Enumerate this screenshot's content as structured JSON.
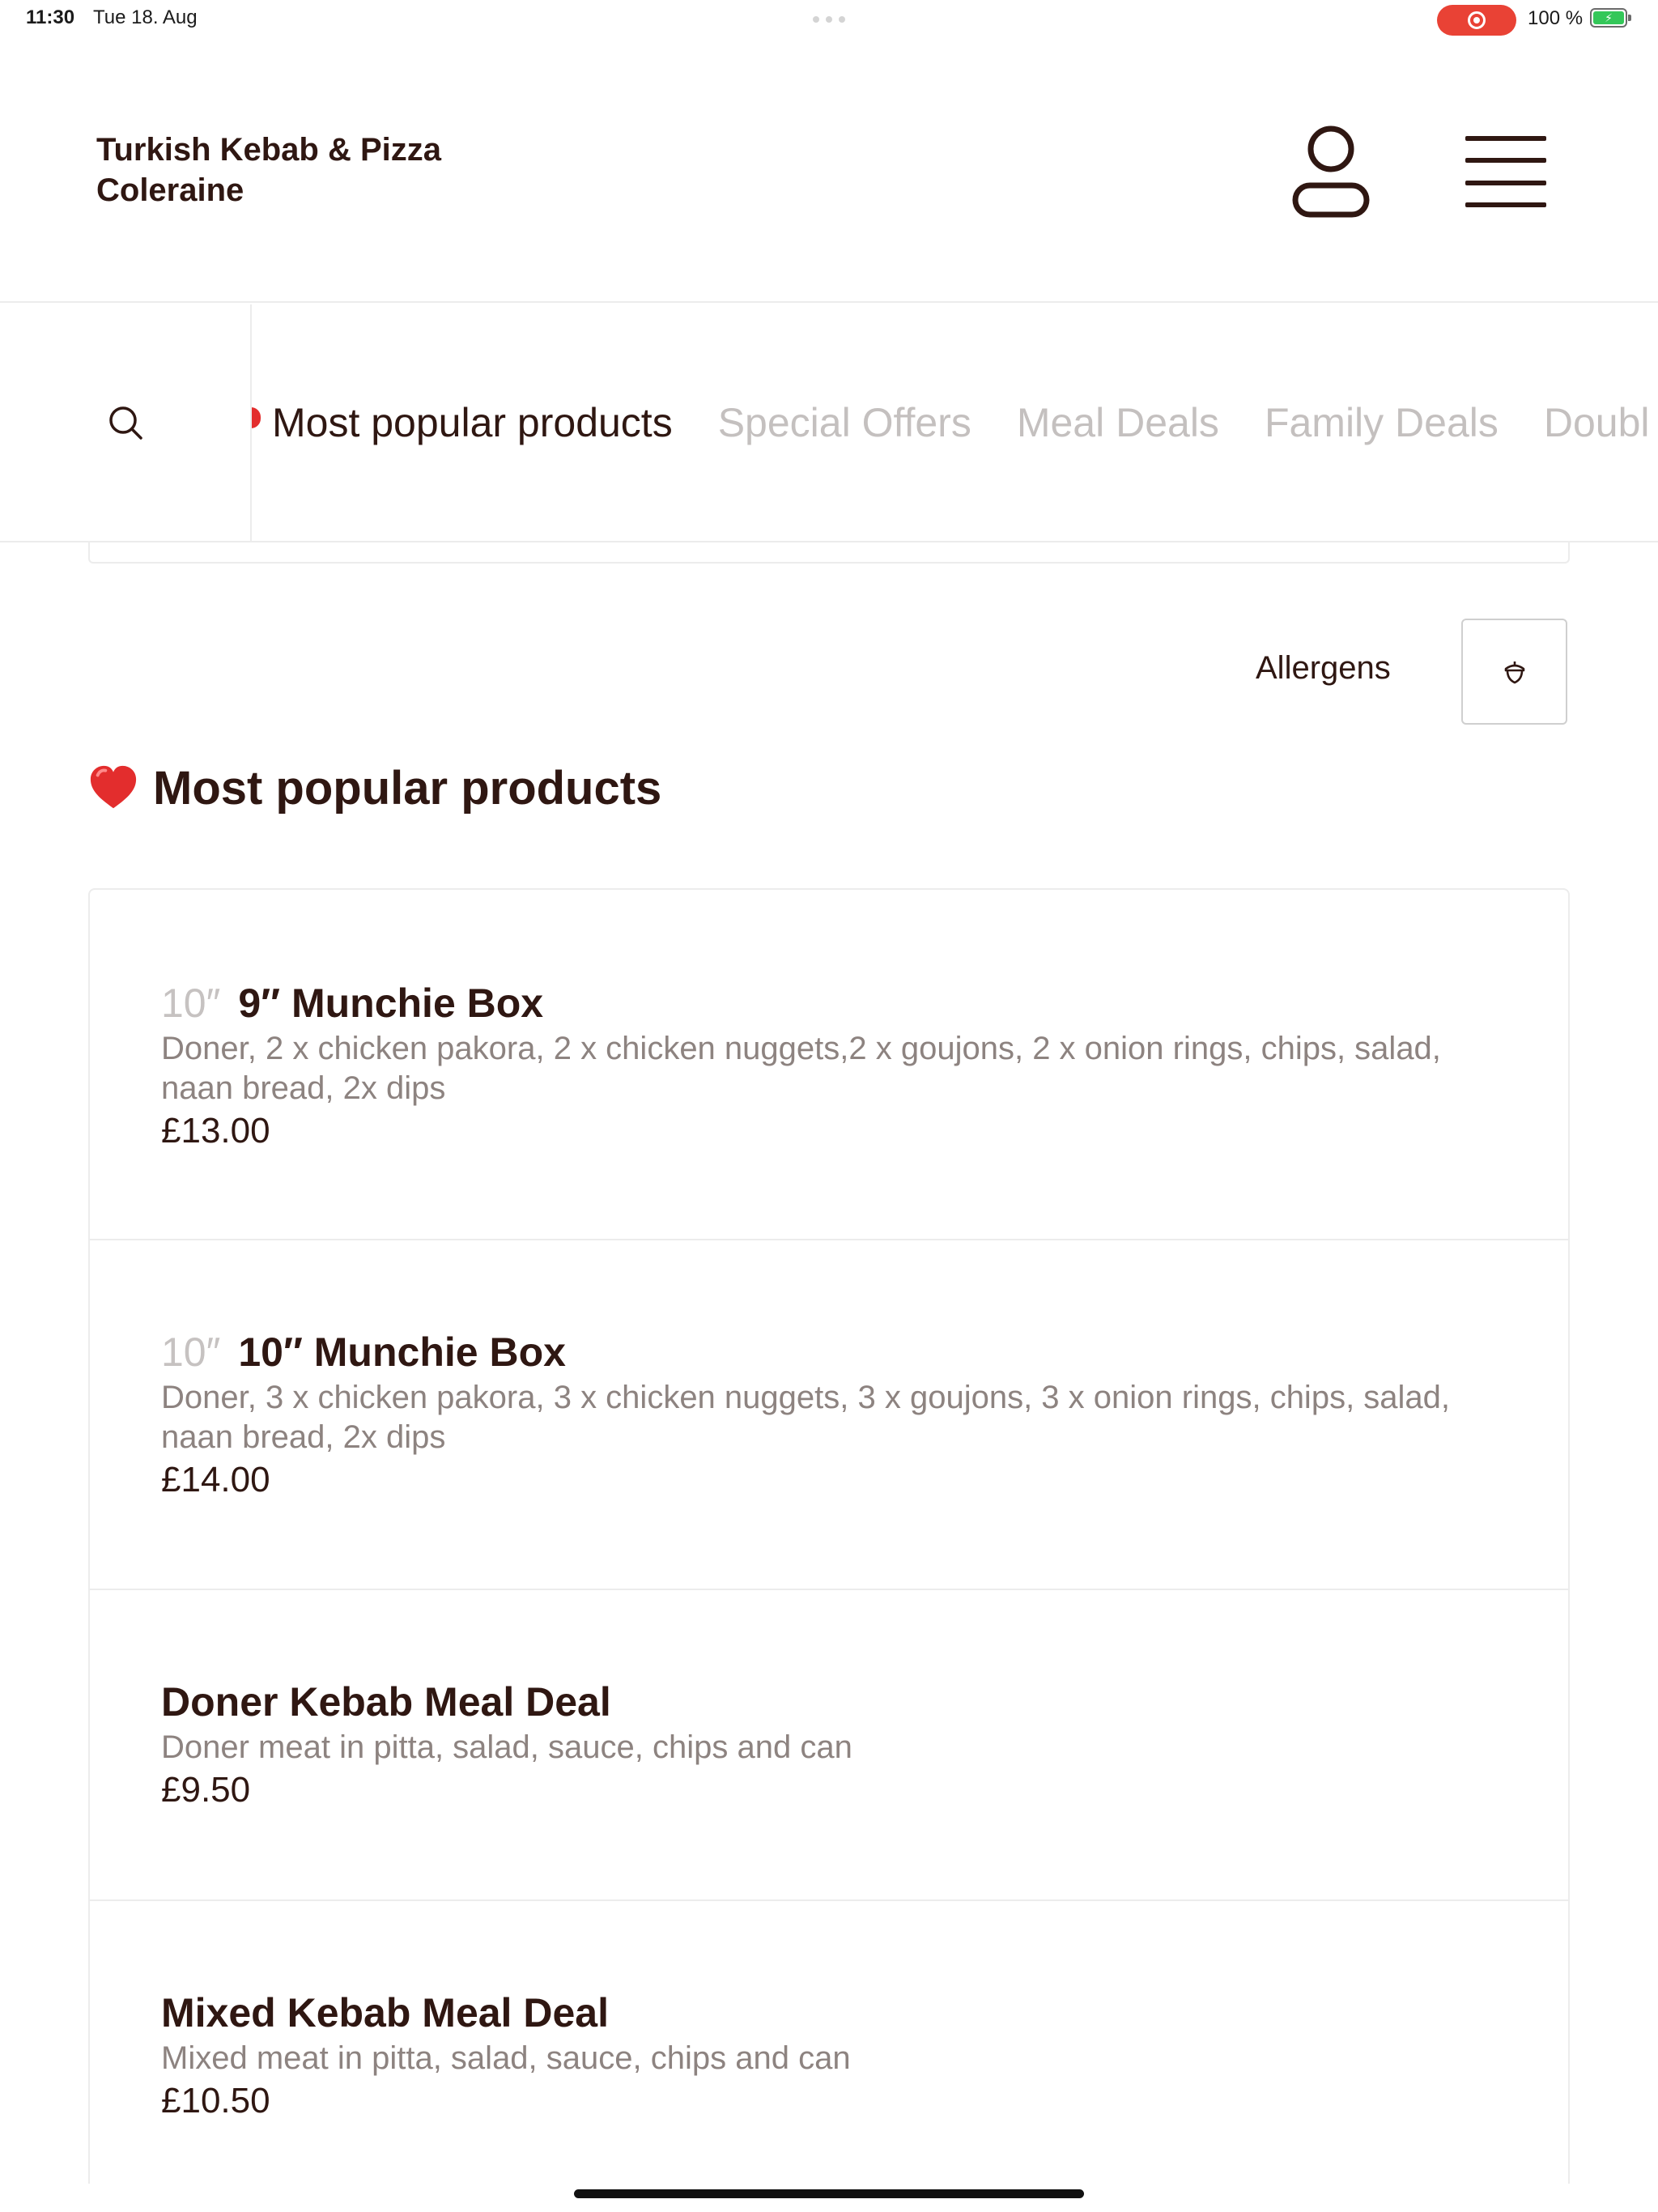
{
  "status_bar": {
    "time": "11:30",
    "date": "Tue 18. Aug",
    "battery": "100 %",
    "battery_symbol": "⚡"
  },
  "header": {
    "brand_line1": "Turkish Kebab & Pizza",
    "brand_line2": "Coleraine",
    "account_icon": "user-icon",
    "menu_icon": "hamburger-icon"
  },
  "category_nav": {
    "search_icon": "search-icon",
    "tabs": [
      {
        "label": "Most popular products",
        "active": true
      },
      {
        "label": "Special Offers",
        "active": false
      },
      {
        "label": "Meal Deals",
        "active": false
      },
      {
        "label": "Family Deals",
        "active": false
      },
      {
        "label": "Doubl",
        "active": false
      }
    ]
  },
  "allergens": {
    "label": "Allergens",
    "icon": "acorn-icon"
  },
  "section": {
    "title": "Most popular products",
    "icon": "heart-icon"
  },
  "products": [
    {
      "size": "10″",
      "name": "9″ Munchie Box",
      "description": "Doner, 2 x chicken pakora, 2 x chicken nuggets,2 x goujons, 2 x onion rings, chips, salad, naan bread, 2x dips",
      "price": "£13.00"
    },
    {
      "size": "10″",
      "name": "10″ Munchie Box",
      "description": "Doner, 3 x chicken pakora, 3 x chicken nuggets, 3 x goujons, 3 x onion rings, chips, salad, naan bread, 2x dips",
      "price": "£14.00"
    },
    {
      "size": "",
      "name": "Doner Kebab Meal Deal",
      "description": "Doner meat in pitta, salad, sauce, chips and can",
      "price": "£9.50"
    },
    {
      "size": "",
      "name": "Mixed Kebab Meal Deal",
      "description": "Mixed meat in pitta, salad, sauce, chips and can",
      "price": "£10.50"
    }
  ],
  "colors": {
    "text_primary": "#2f1712",
    "text_muted": "#8d8380",
    "tab_inactive": "#c4c0bf",
    "accent_red": "#e32d2d",
    "record_red": "#e94235",
    "battery_green": "#34c759",
    "border": "#ececec"
  }
}
